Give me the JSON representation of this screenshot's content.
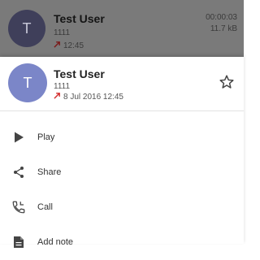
{
  "background_row": {
    "avatar_letter": "T",
    "name": "Test User",
    "number": "1111",
    "call_time": "12:45",
    "duration": "00:00:03",
    "size": "11.7 kB"
  },
  "sheet": {
    "avatar_letter": "T",
    "name": "Test User",
    "number": "1111",
    "call_datetime": "8 Jul 2016 12:45",
    "star_icon": "star-outline-icon",
    "colors": {
      "avatar": "#7b86c8",
      "outgoing_arrow": "#d32f2f"
    }
  },
  "menu": {
    "items": [
      {
        "label": "Play",
        "icon": "play-icon"
      },
      {
        "label": "Share",
        "icon": "share-icon"
      },
      {
        "label": "Call",
        "icon": "phone-icon"
      },
      {
        "label": "Add note",
        "icon": "note-icon"
      }
    ]
  }
}
